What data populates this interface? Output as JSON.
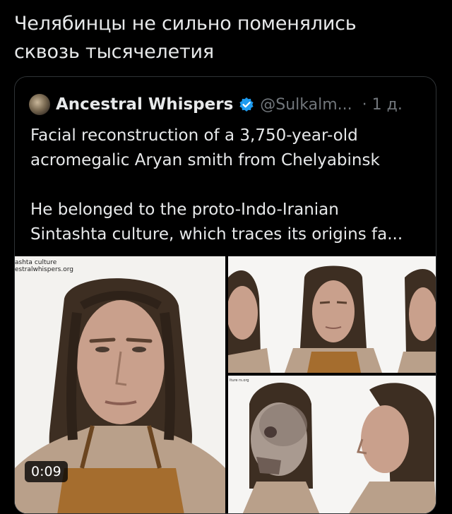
{
  "post": {
    "text": "Челябинцы не сильно поменялись\nсквозь тысячелетия"
  },
  "quote": {
    "author_name": "Ancestral Whispers",
    "handle": "@Sulkalm...",
    "time": "· 1 д.",
    "text": "Facial reconstruction of a 3,750-year-old\nacromegalic Aryan smith from Chelyabinsk\n\nHe belonged to the proto-Indo-Iranian\nSintashta culture, which traces its origins fa...",
    "icons": [
      "avatar",
      "verified-badge-icon"
    ],
    "accent_color": "#1d9bf0"
  },
  "media": {
    "watermark": "ashta culture\nestralwhispers.org",
    "watermark_small": "lture\nrs.org",
    "video_duration": "0:09"
  }
}
